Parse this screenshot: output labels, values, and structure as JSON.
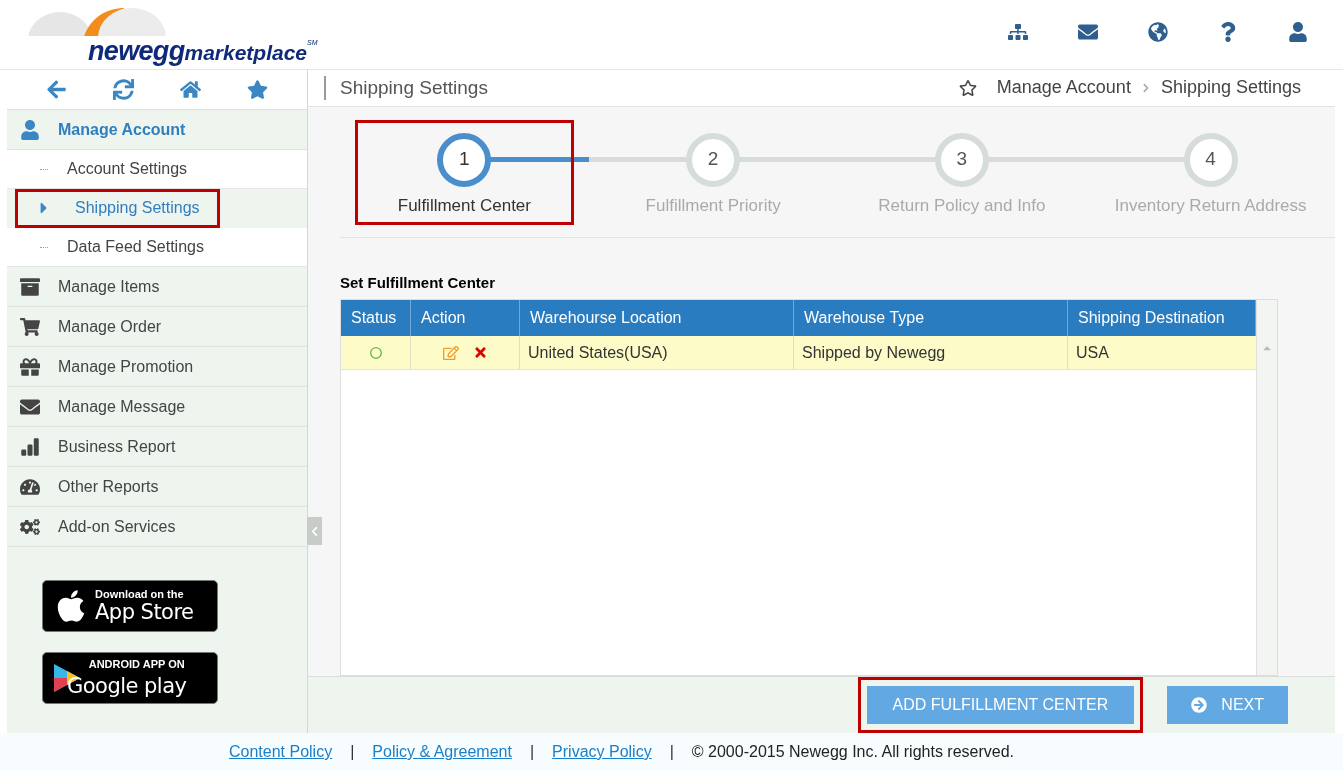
{
  "logo": {
    "brand": "newegg",
    "product": "marketplace",
    "mark": "SM"
  },
  "sidebar": {
    "items": [
      {
        "label": "Manage Account",
        "expanded": true,
        "children": [
          {
            "label": "Account Settings",
            "selected": false,
            "annotated": false
          },
          {
            "label": "Shipping Settings",
            "selected": true,
            "annotated": true
          },
          {
            "label": "Data Feed Settings",
            "selected": false,
            "annotated": false
          }
        ]
      },
      {
        "label": "Manage Items",
        "expanded": false
      },
      {
        "label": "Manage Order",
        "expanded": false
      },
      {
        "label": "Manage Promotion",
        "expanded": false
      },
      {
        "label": "Manage Message",
        "expanded": false
      },
      {
        "label": "Business Report",
        "expanded": false
      },
      {
        "label": "Other Reports",
        "expanded": false
      },
      {
        "label": "Add-on Services",
        "expanded": false
      }
    ],
    "badges": [
      {
        "kind": "apple",
        "small": "Download on the",
        "big": "App Store"
      },
      {
        "kind": "google",
        "small": "ANDROID APP ON",
        "big": "Google play"
      }
    ]
  },
  "page": {
    "title": "Shipping Settings",
    "breadcrumb": [
      "Manage Account",
      "Shipping Settings"
    ]
  },
  "steps": [
    {
      "number": "1",
      "label": "Fulfillment Center",
      "selected": true,
      "annotated": true
    },
    {
      "number": "2",
      "label": "Fulfillment Priority",
      "selected": false,
      "annotated": false
    },
    {
      "number": "3",
      "label": "Return Policy and Info",
      "selected": false,
      "annotated": false
    },
    {
      "number": "4",
      "label": "Inventory Return Address",
      "selected": false,
      "annotated": false
    }
  ],
  "table": {
    "title": "Set Fulfillment Center",
    "columns": [
      "Status",
      "Action",
      "Warehourse Location",
      "Warehouse Type",
      "Shipping Destination"
    ],
    "rows": [
      {
        "selected": true,
        "location": "United States(USA)",
        "type": "Shipped by Newegg",
        "destination": "USA"
      }
    ]
  },
  "buttons": [
    {
      "kind": "add",
      "label": "ADD FULFILLMENT CENTER",
      "annotated": true
    },
    {
      "kind": "next",
      "label": "NEXT",
      "annotated": false
    }
  ],
  "footer": [
    {
      "kind": "link",
      "text": "Content Policy"
    },
    {
      "kind": "sep",
      "text": "|"
    },
    {
      "kind": "link",
      "text": "Policy & Agreement"
    },
    {
      "kind": "sep",
      "text": "|"
    },
    {
      "kind": "link",
      "text": "Privacy Policy"
    },
    {
      "kind": "sep",
      "text": "|"
    },
    {
      "kind": "text",
      "text": "© 2000-2015 Newegg Inc. All rights reserved."
    }
  ]
}
